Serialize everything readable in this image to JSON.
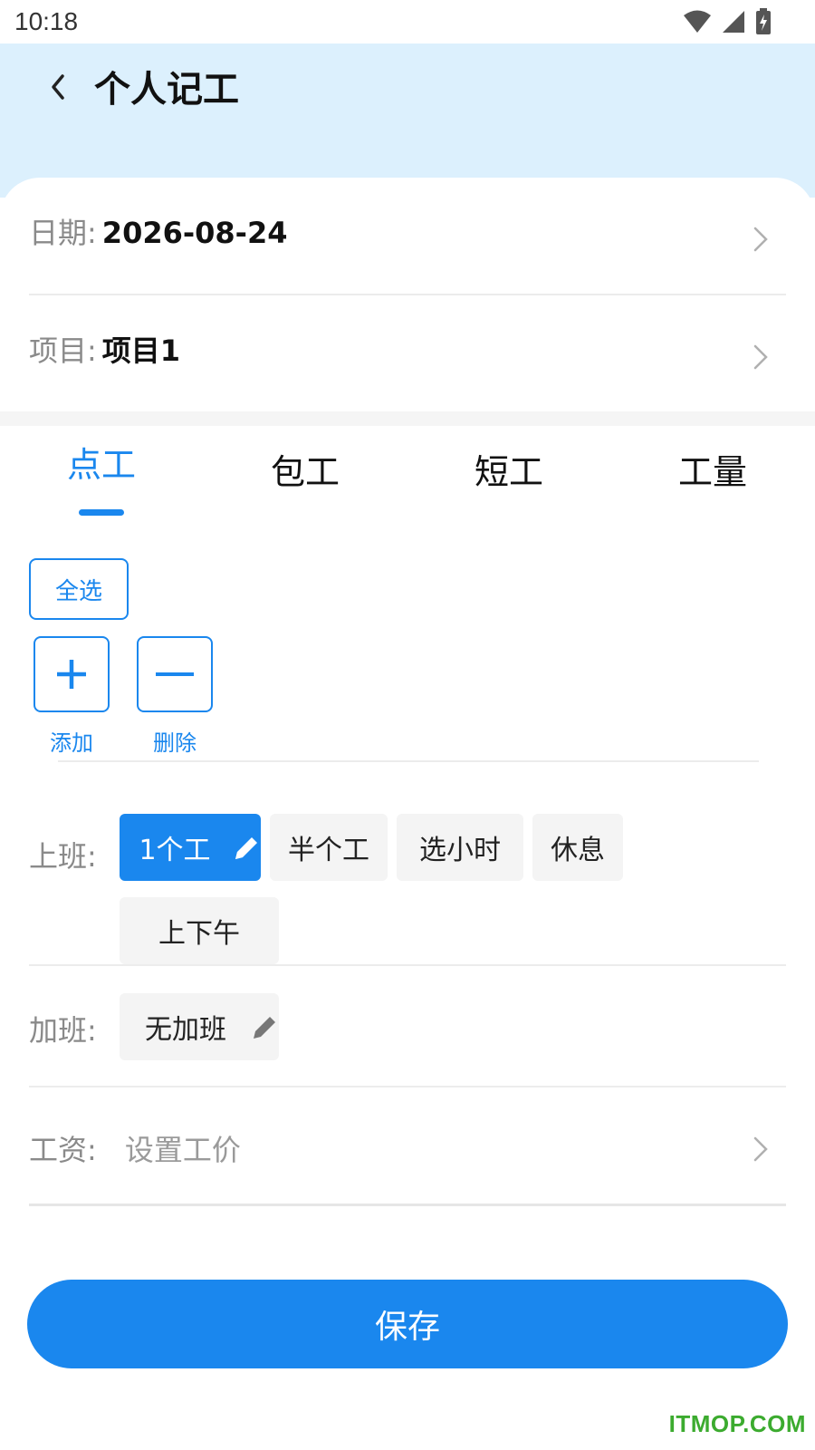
{
  "status_bar": {
    "time": "10:18"
  },
  "header": {
    "title": "个人记工"
  },
  "date_row": {
    "label": "日期:",
    "value": "2026-08-24"
  },
  "project_row": {
    "label": "项目:",
    "value": "项目1"
  },
  "tabs": [
    {
      "label": "点工",
      "active": true
    },
    {
      "label": "包工",
      "active": false
    },
    {
      "label": "短工",
      "active": false
    },
    {
      "label": "工量",
      "active": false
    }
  ],
  "select_all_label": "全选",
  "add_label": "添加",
  "delete_label": "删除",
  "shift": {
    "label": "上班:",
    "options": [
      "1个工",
      "半个工",
      "选小时",
      "休息",
      "上下午"
    ],
    "selected": "1个工"
  },
  "overtime": {
    "label": "加班:",
    "value": "无加班"
  },
  "wage": {
    "label": "工资:",
    "placeholder": "设置工价"
  },
  "save_label": "保存",
  "watermark": "ITMOP.COM",
  "colors": {
    "accent": "#1a87ee",
    "header_bg": "#dcf0fd",
    "watermark": "#3cab2f"
  }
}
